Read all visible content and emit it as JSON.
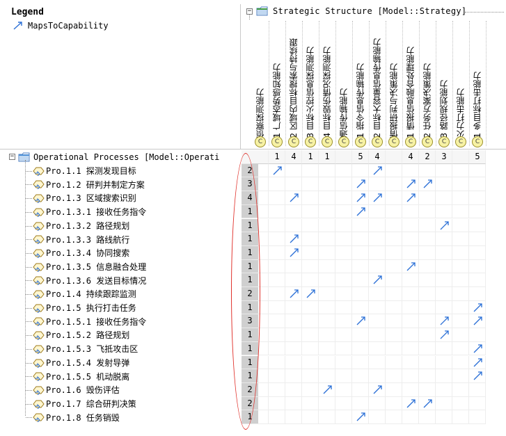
{
  "legend": {
    "title": "Legend",
    "item_label": "MapsToCapability",
    "arrow_color": "#2a6fd6"
  },
  "column_root": {
    "label": "Strategic Structure [Model::Strategy]",
    "toggle": "−"
  },
  "row_root": {
    "label": "Operational Processes [Model::Operati",
    "toggle": "−"
  },
  "columns": [
    {
      "label": "1 侦察探测能力"
    },
    {
      "label": "1.1 广域态势感知能力"
    },
    {
      "label": "1.2 区域内目标搜索与持续跟"
    },
    {
      "label": "1.3 目标火控信息探测能力"
    },
    {
      "label": "1.4 目标毁伤情况探测能力"
    },
    {
      "label": "2 通信传输能力"
    },
    {
      "label": "2.1 指令信息传输能力"
    },
    {
      "label": "2.2 目标大容量信息传输能力"
    },
    {
      "label": "3 情报研判与决策能力"
    },
    {
      "label": "3.1 情报信息融合处理能力"
    },
    {
      "label": "3.2 任务方案决策能力"
    },
    {
      "label": "3.3 路径规划能力"
    },
    {
      "label": "4 火力打击能力"
    },
    {
      "label": "4.1 多目标打击能力"
    }
  ],
  "column_icon_glyph": "C",
  "column_counts": [
    "",
    "1",
    "4",
    "1",
    "1",
    "",
    "5",
    "4",
    "",
    "4",
    "2",
    "3",
    "",
    "5"
  ],
  "rows": [
    {
      "label": "Pro.1.1 探测发现目标",
      "count": "2",
      "marks": [
        1,
        7
      ]
    },
    {
      "label": "Pro.1.2 研判并制定方案",
      "count": "3",
      "marks": [
        6,
        9,
        10
      ]
    },
    {
      "label": "Pro.1.3 区域搜索识别",
      "count": "4",
      "marks": [
        2,
        6,
        7,
        9
      ]
    },
    {
      "label": "Pro.1.3.1 接收任务指令",
      "count": "1",
      "marks": [
        6
      ]
    },
    {
      "label": "Pro.1.3.2 路径规划",
      "count": "1",
      "marks": [
        11
      ]
    },
    {
      "label": "Pro.1.3.3 路线航行",
      "count": "1",
      "marks": [
        2
      ]
    },
    {
      "label": "Pro.1.3.4 协同搜索",
      "count": "1",
      "marks": [
        2
      ]
    },
    {
      "label": "Pro.1.3.5 信息融合处理",
      "count": "1",
      "marks": [
        9
      ]
    },
    {
      "label": "Pro.1.3.6 发送目标情况",
      "count": "1",
      "marks": [
        7
      ]
    },
    {
      "label": "Pro.1.4 持续跟踪监测",
      "count": "2",
      "marks": [
        2,
        3
      ]
    },
    {
      "label": "Pro.1.5 执行打击任务",
      "count": "1",
      "marks": [
        13
      ]
    },
    {
      "label": "Pro.1.5.1 接收任务指令",
      "count": "3",
      "marks": [
        6,
        11,
        13
      ]
    },
    {
      "label": "Pro.1.5.2 路径规划",
      "count": "1",
      "marks": [
        11
      ]
    },
    {
      "label": "Pro.1.5.3 飞抵攻击区",
      "count": "1",
      "marks": [
        13
      ]
    },
    {
      "label": "Pro.1.5.4 发射导弹",
      "count": "1",
      "marks": [
        13
      ]
    },
    {
      "label": "Pro.1.5.5 机动脱离",
      "count": "1",
      "marks": [
        13
      ]
    },
    {
      "label": "Pro.1.6 毁伤评估",
      "count": "2",
      "marks": [
        4,
        7
      ]
    },
    {
      "label": "Pro.1.7 综合研判决策",
      "count": "2",
      "marks": [
        9,
        10
      ]
    },
    {
      "label": "Pro.1.8 任务销毁",
      "count": "1",
      "marks": [
        6
      ]
    }
  ],
  "colors": {
    "arrow": "#2a6fd6",
    "count_bg": "#cfcfcf",
    "highlight_oval": "#e0302a",
    "folder": "#4c8fd6",
    "process_icon": "#e8c95a"
  }
}
